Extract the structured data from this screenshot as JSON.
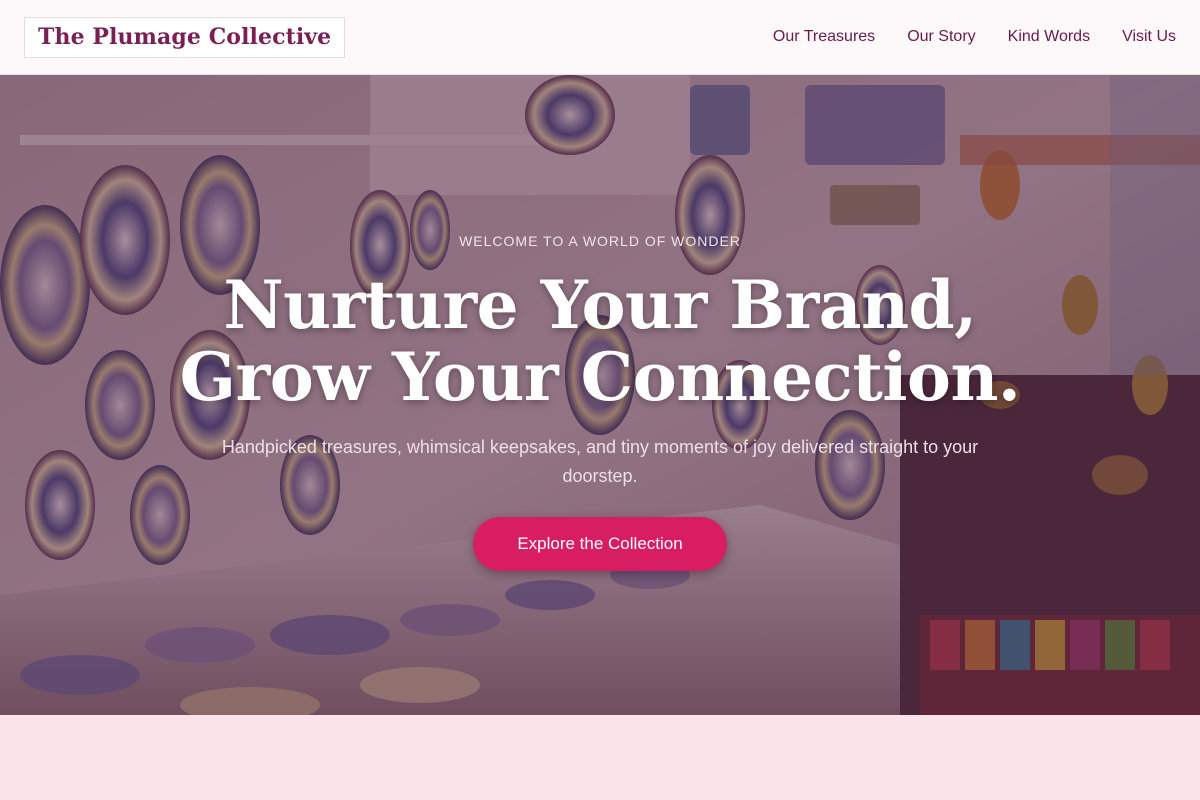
{
  "brand": {
    "name": "The Plumage Collective"
  },
  "nav": {
    "items": [
      {
        "label": "Our Treasures"
      },
      {
        "label": "Our Story"
      },
      {
        "label": "Kind Words"
      },
      {
        "label": "Visit Us"
      }
    ]
  },
  "hero": {
    "eyebrow": "WELCOME TO A WORLD OF WONDER",
    "headline_line1": "Nurture Your Brand,",
    "headline_line2": "Grow Your Connection.",
    "subtext": "Handpicked treasures, whimsical keepsakes, and tiny moments of joy delivered straight to your doorstep.",
    "cta_label": "Explore the Collection",
    "image_description_icon": "pottery-shop-photo"
  },
  "colors": {
    "brand": "#7a1f55",
    "nav_text": "#6b1a4c",
    "cta": "#d81d63",
    "page_background": "#fbe3ea",
    "header_background": "#fdf8f9"
  }
}
